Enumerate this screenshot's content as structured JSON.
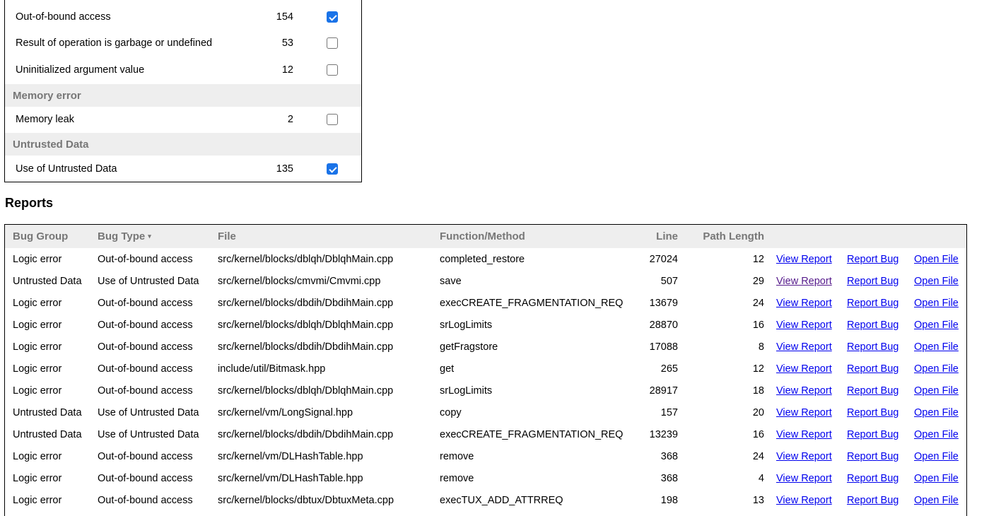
{
  "summary": {
    "rows": [
      {
        "label": "Out-of-bound access",
        "count": "154",
        "checked": true
      },
      {
        "label": "Result of operation is garbage or undefined",
        "count": "53",
        "checked": false
      },
      {
        "label": "Uninitialized argument value",
        "count": "12",
        "checked": false
      }
    ],
    "groups": [
      {
        "name": "Memory error",
        "rows": [
          {
            "label": "Memory leak",
            "count": "2",
            "checked": false
          }
        ]
      },
      {
        "name": "Untrusted Data",
        "rows": [
          {
            "label": "Use of Untrusted Data",
            "count": "135",
            "checked": true
          }
        ]
      }
    ]
  },
  "reports": {
    "title": "Reports",
    "columns": {
      "bug_group": "Bug Group",
      "bug_type": "Bug Type",
      "sort_indicator": "▾",
      "file": "File",
      "function": "Function/Method",
      "line": "Line",
      "path_length": "Path Length"
    },
    "link_labels": {
      "view": "View Report",
      "report_bug": "Report Bug",
      "open": "Open File"
    },
    "rows": [
      {
        "group": "Logic error",
        "type": "Out-of-bound access",
        "file": "src/kernel/blocks/dblqh/DblqhMain.cpp",
        "func": "completed_restore",
        "line": "27024",
        "path": "12",
        "view_visited": false
      },
      {
        "group": "Untrusted Data",
        "type": "Use of Untrusted Data",
        "file": "src/kernel/blocks/cmvmi/Cmvmi.cpp",
        "func": "save",
        "line": "507",
        "path": "29",
        "view_visited": true
      },
      {
        "group": "Logic error",
        "type": "Out-of-bound access",
        "file": "src/kernel/blocks/dbdih/DbdihMain.cpp",
        "func": "execCREATE_FRAGMENTATION_REQ",
        "line": "13679",
        "path": "24",
        "view_visited": false
      },
      {
        "group": "Logic error",
        "type": "Out-of-bound access",
        "file": "src/kernel/blocks/dblqh/DblqhMain.cpp",
        "func": "srLogLimits",
        "line": "28870",
        "path": "16",
        "view_visited": false
      },
      {
        "group": "Logic error",
        "type": "Out-of-bound access",
        "file": "src/kernel/blocks/dbdih/DbdihMain.cpp",
        "func": "getFragstore",
        "line": "17088",
        "path": "8",
        "view_visited": false
      },
      {
        "group": "Logic error",
        "type": "Out-of-bound access",
        "file": "include/util/Bitmask.hpp",
        "func": "get",
        "line": "265",
        "path": "12",
        "view_visited": false
      },
      {
        "group": "Logic error",
        "type": "Out-of-bound access",
        "file": "src/kernel/blocks/dblqh/DblqhMain.cpp",
        "func": "srLogLimits",
        "line": "28917",
        "path": "18",
        "view_visited": false
      },
      {
        "group": "Untrusted Data",
        "type": "Use of Untrusted Data",
        "file": "src/kernel/vm/LongSignal.hpp",
        "func": "copy",
        "line": "157",
        "path": "20",
        "view_visited": false
      },
      {
        "group": "Untrusted Data",
        "type": "Use of Untrusted Data",
        "file": "src/kernel/blocks/dbdih/DbdihMain.cpp",
        "func": "execCREATE_FRAGMENTATION_REQ",
        "line": "13239",
        "path": "16",
        "view_visited": false
      },
      {
        "group": "Logic error",
        "type": "Out-of-bound access",
        "file": "src/kernel/vm/DLHashTable.hpp",
        "func": "remove",
        "line": "368",
        "path": "24",
        "view_visited": false
      },
      {
        "group": "Logic error",
        "type": "Out-of-bound access",
        "file": "src/kernel/vm/DLHashTable.hpp",
        "func": "remove",
        "line": "368",
        "path": "4",
        "view_visited": false
      },
      {
        "group": "Logic error",
        "type": "Out-of-bound access",
        "file": "src/kernel/blocks/dbtux/DbtuxMeta.cpp",
        "func": "execTUX_ADD_ATTRREQ",
        "line": "198",
        "path": "13",
        "view_visited": false
      }
    ]
  }
}
